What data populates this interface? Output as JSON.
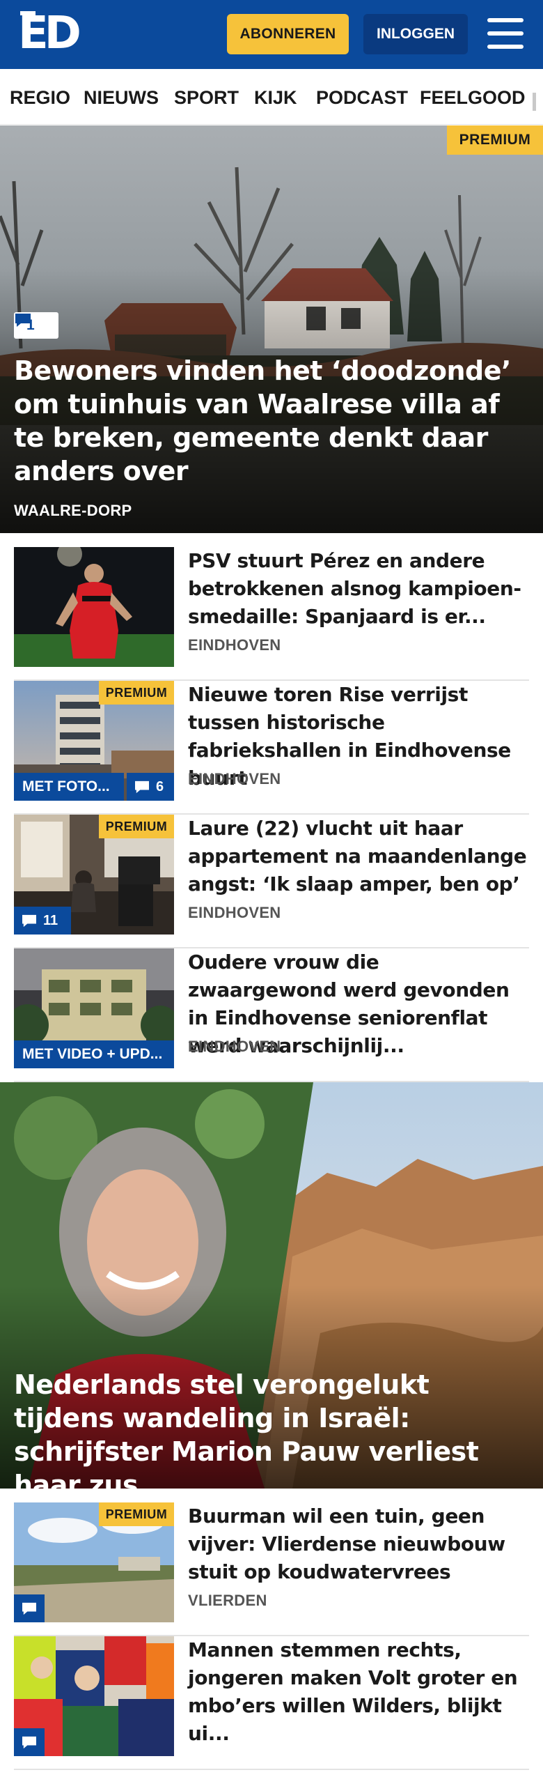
{
  "header": {
    "logo": "ED",
    "subscribe_label": "ABONNEREN",
    "login_label": "INLOGGEN",
    "menu_icon": "hamburger-menu-icon",
    "brand_color": "#0b4a9c",
    "accent_color": "#f6c23a"
  },
  "nav": {
    "items": [
      "REGIO",
      "NIEUWS",
      "SPORT",
      "KIJK",
      "PODCAST",
      "FEELGOOD"
    ]
  },
  "hero": {
    "badge": "PREMIUM",
    "comments": "1",
    "title": "Bewoners vinden het ‘doodzonde’ om tuinhuis van Waalrese villa af te breken, gemeente denkt daar anders over",
    "location": "WAALRE-DORP"
  },
  "articles": [
    {
      "title": "PSV stuurt Pérez en andere betrokkenen alsnog kampioen­smedaille: Spanjaard is er...",
      "location": "EINDHOVEN"
    },
    {
      "title": "Nieuwe toren Rise verrijst tussen historische fabriekshallen in Eindhovense buurt",
      "location": "EINDHOVEN",
      "badge": "PREMIUM",
      "label": "MET FOTO...",
      "comments": "6"
    },
    {
      "title": "Laure (22) vlucht uit haar appartement na maandenlange angst: ‘Ik slaap amper, ben op’",
      "location": "EINDHOVEN",
      "badge": "PREMIUM",
      "comments": "11"
    },
    {
      "title": "Oudere vrouw die zwaargewond werd gevonden in Eindhovense seniorenflat werd waarschijnlij...",
      "location": "EINDHOVEN",
      "label": "MET VIDEO + UPD..."
    }
  ],
  "big_story": {
    "title": "Nederlands stel verongelukt tijdens wandeling in Israël: schrijfster Marion Pauw verliest haar zus"
  },
  "articles_2": [
    {
      "title": "Buurman wil een tuin, geen vijver: Vlierdense nieuwbouw stuit op koudwatervrees",
      "location": "VLIERDEN",
      "badge": "PREMIUM"
    },
    {
      "title": "Mannen stemmen rechts, jongeren maken Volt groter en mbo’ers willen Wilders, blijkt ui..."
    }
  ]
}
